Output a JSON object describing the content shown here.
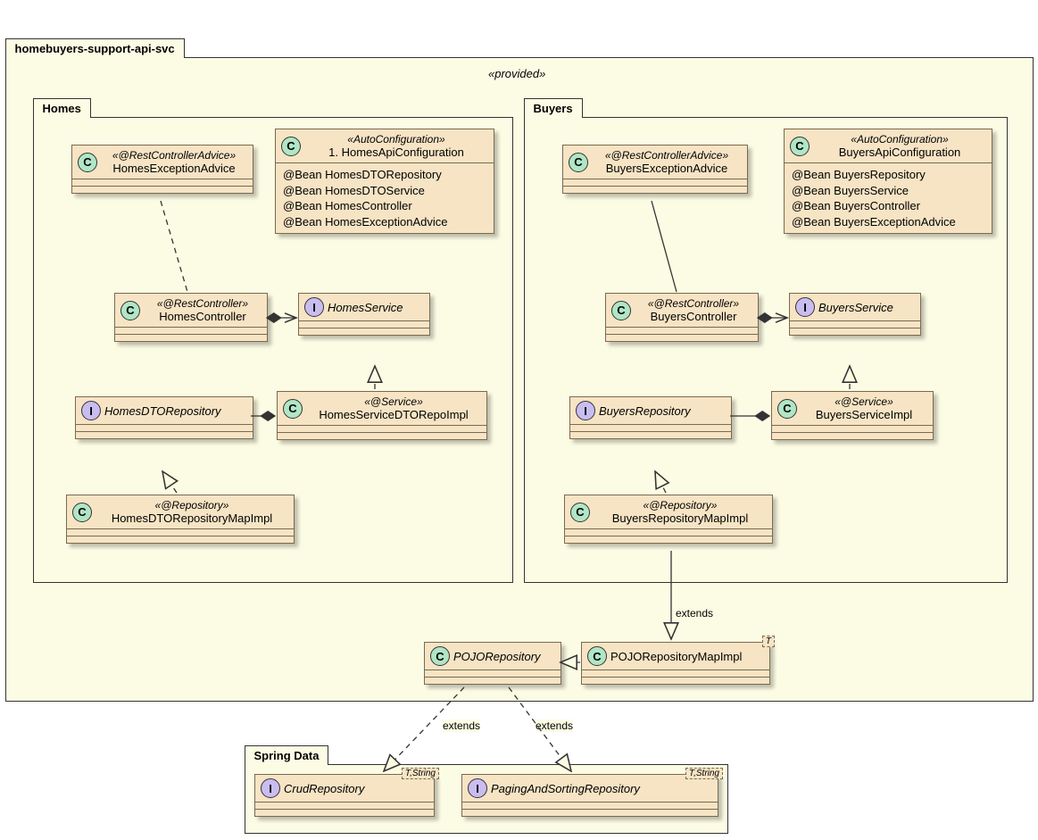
{
  "outer": {
    "label": "homebuyers-support-api-svc",
    "provided": "«provided»"
  },
  "homes": {
    "label": "Homes",
    "exceptionAdvice": {
      "stereo": "«@RestControllerAdvice»",
      "name": "HomesExceptionAdvice"
    },
    "config": {
      "stereo": "«AutoConfiguration»",
      "name": "1. HomesApiConfiguration",
      "beans": [
        "@Bean HomesDTORepository",
        "@Bean HomesDTOService",
        "@Bean HomesController",
        "@Bean HomesExceptionAdvice"
      ]
    },
    "controller": {
      "stereo": "«@RestController»",
      "name": "HomesController"
    },
    "service": {
      "name": "HomesService"
    },
    "repo": {
      "name": "HomesDTORepository"
    },
    "serviceImpl": {
      "stereo": "«@Service»",
      "name": "HomesServiceDTORepoImpl"
    },
    "repoImpl": {
      "stereo": "«@Repository»",
      "name": "HomesDTORepositoryMapImpl"
    }
  },
  "buyers": {
    "label": "Buyers",
    "exceptionAdvice": {
      "stereo": "«@RestControllerAdvice»",
      "name": "BuyersExceptionAdvice"
    },
    "config": {
      "stereo": "«AutoConfiguration»",
      "name": "BuyersApiConfiguration",
      "beans": [
        "@Bean BuyersRepository",
        "@Bean BuyersService",
        "@Bean BuyersController",
        "@Bean BuyersExceptionAdvice"
      ]
    },
    "controller": {
      "stereo": "«@RestController»",
      "name": "BuyersController"
    },
    "service": {
      "name": "BuyersService"
    },
    "repo": {
      "name": "BuyersRepository"
    },
    "serviceImpl": {
      "stereo": "«@Service»",
      "name": "BuyersServiceImpl"
    },
    "repoImpl": {
      "stereo": "«@Repository»",
      "name": "BuyersRepositoryMapImpl"
    }
  },
  "pojoRepo": {
    "name": "POJORepository"
  },
  "pojoRepoImpl": {
    "name": "POJORepositoryMapImpl",
    "typeparam": "T"
  },
  "spring": {
    "label": "Spring Data",
    "crud": {
      "name": "CrudRepository",
      "typeparam": "T,String"
    },
    "paging": {
      "name": "PagingAndSortingRepository",
      "typeparam": "T,String"
    }
  },
  "labels": {
    "extends": "extends"
  }
}
